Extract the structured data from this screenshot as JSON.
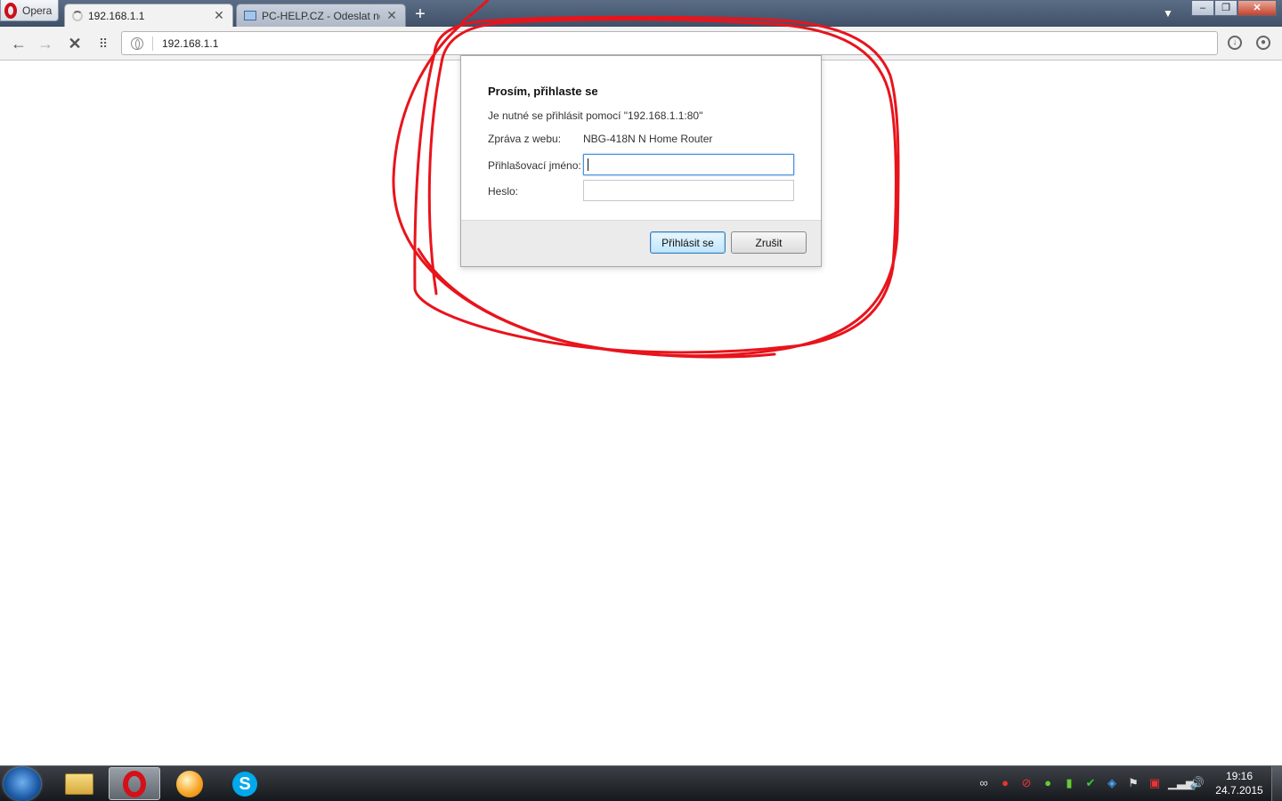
{
  "browser": {
    "menu_label": "Opera",
    "tabs": [
      {
        "label": "192.168.1.1",
        "close": "✕"
      },
      {
        "label": "PC-HELP.CZ - Odeslat nov",
        "close": "✕"
      }
    ],
    "new_tab": "+",
    "address": "192.168.1.1"
  },
  "dialog": {
    "title": "Prosím, přihlaste se",
    "message": "Je nutné se přihlásit pomocí \"192.168.1.1:80\"",
    "site_message_label": "Zpráva z webu:",
    "site_message_value": "NBG-418N N Home Router",
    "username_label": "Přihlašovací jméno:",
    "username_value": "",
    "password_label": "Heslo:",
    "password_value": "",
    "login_button": "Přihlásit se",
    "cancel_button": "Zrušit"
  },
  "taskbar": {
    "clock_time": "19:16",
    "clock_date": "24.7.2015",
    "apps": [
      "explorer",
      "opera",
      "bubble-app",
      "skype"
    ]
  },
  "colors": {
    "annotation": "#e8141c",
    "accent": "#4a90d9"
  }
}
